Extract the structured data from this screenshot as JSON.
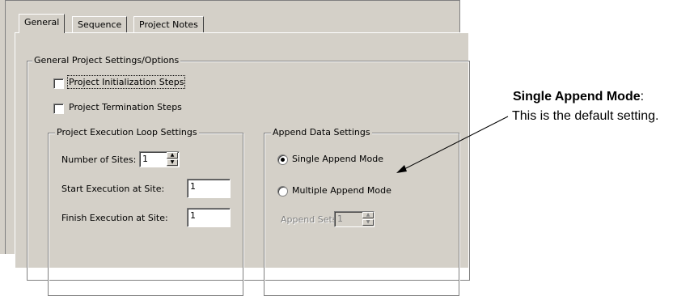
{
  "tabs": [
    "General",
    "Sequence",
    "Project Notes"
  ],
  "general_group": {
    "title": "General Project Settings/Options",
    "init_steps": {
      "label": "Project Initialization Steps",
      "checked": false
    },
    "term_steps": {
      "label": "Project Termination Steps",
      "checked": false
    }
  },
  "loop_group": {
    "title": "Project Execution Loop Settings",
    "num_sites": {
      "label": "Number of Sites:",
      "value": "1"
    },
    "start_site": {
      "label": "Start Execution at Site:",
      "value": "1"
    },
    "finish_site": {
      "label": "Finish Execution at Site:",
      "value": "1"
    }
  },
  "append_group": {
    "title": "Append Data Settings",
    "single": {
      "label": "Single Append Mode",
      "selected": true
    },
    "multiple": {
      "label": "Multiple Append Mode",
      "selected": false
    },
    "sets": {
      "label": "Append Sets:",
      "value": "1",
      "enabled": false
    }
  },
  "annotation": {
    "title": "Single Append Mode",
    "colon": ":",
    "body": "This is the default setting."
  }
}
